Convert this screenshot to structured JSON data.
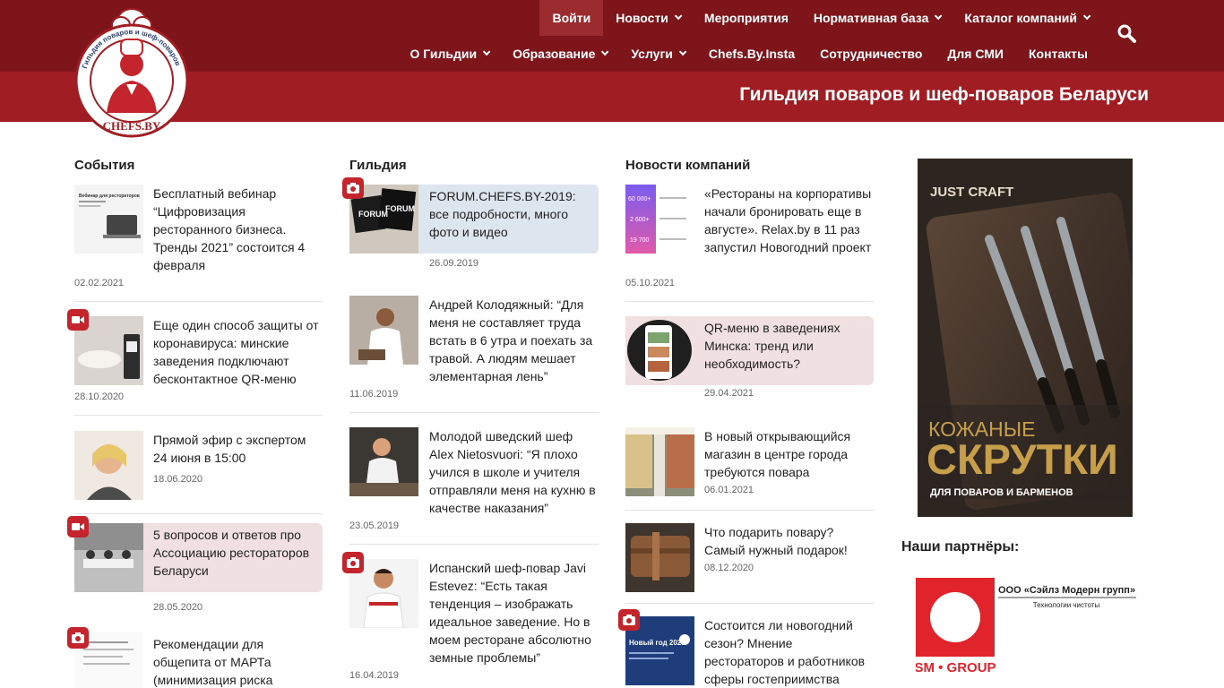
{
  "site": {
    "title": "Гильдия поваров и шеф-поваров Беларуси",
    "logo_ring_text": "Гильдия поваров и шеф-поваров",
    "logo_domain": "CHEFS.BY"
  },
  "nav": {
    "row1": [
      {
        "label": "Войти",
        "dropdown": false,
        "active": true
      },
      {
        "label": "Новости",
        "dropdown": true
      },
      {
        "label": "Мероприятия",
        "dropdown": false
      },
      {
        "label": "Нормативная база",
        "dropdown": true
      },
      {
        "label": "Каталог компаний",
        "dropdown": true
      }
    ],
    "row2": [
      {
        "label": "О Гильдии",
        "dropdown": true
      },
      {
        "label": "Образование",
        "dropdown": true
      },
      {
        "label": "Услуги",
        "dropdown": true
      },
      {
        "label": "Chefs.By.Insta",
        "dropdown": false
      },
      {
        "label": "Сотрудничество",
        "dropdown": false
      },
      {
        "label": "Для СМИ",
        "dropdown": false
      },
      {
        "label": "Контакты",
        "dropdown": false
      }
    ],
    "search_icon": "search-icon"
  },
  "columns": {
    "events": {
      "title": "События",
      "items": [
        {
          "text": "Бесплатный вебинар “Цифровизация ресторанного бизнеса. Тренды 2021” состоится 4 февраля",
          "date": "02.02.2021"
        },
        {
          "text": "Еще один способ защиты от коронавируса: минские заведения подключают бесконтактное QR-меню",
          "date": "28.10.2020",
          "badge": "video-icon"
        },
        {
          "text": "Прямой эфир с экспертом 24 июня в 15:00",
          "date": "18.06.2020"
        },
        {
          "text": "5 вопросов и ответов про Ассоциацию рестораторов Беларуси",
          "date": "28.05.2020",
          "badge": "video-icon"
        },
        {
          "text": "Рекомендации для общепита от МАРТа (минимизация риска",
          "date": "",
          "badge": "camera-icon"
        }
      ]
    },
    "guild": {
      "title": "Гильдия",
      "items": [
        {
          "text": "FORUM.CHEFS.BY-2019: все подробности, много фото и видео",
          "date": "26.09.2019",
          "badge": "camera-icon"
        },
        {
          "text": "Андрей Колодяжный: “Для меня не составляет труда встать в 6 утра и поехать за травой. А людям мешает элементарная лень”",
          "date": "11.06.2019"
        },
        {
          "text": "Молодой шведский шеф Alex Nietosvuori: “Я плохо учился в школе и учителя отправляли меня на кухню в качестве наказания”",
          "date": "23.05.2019"
        },
        {
          "text": "Испанский шеф-повар Javi Estevez: “Есть такая тенденция – изображать идеальное заведение. Но в моем ресторане абсолютно земные проблемы”",
          "date": "16.04.2019",
          "badge": "camera-icon"
        }
      ]
    },
    "companies": {
      "title": "Новости компаний",
      "items": [
        {
          "text": "«Рестораны на корпоративы начали бронировать еще в августе». Relax.by в 11 раз запустил Новогодний проект",
          "date": "05.10.2021"
        },
        {
          "text": "QR-меню в заведениях Минска: тренд или необходимость?",
          "date": "29.04.2021"
        },
        {
          "text": "В новый открывающийся магазин в центре города требуются повара",
          "date": "06.01.2021"
        },
        {
          "text": "Что подарить повару? Самый нужный подарок!",
          "date": "08.12.2020"
        },
        {
          "text": "Состоится ли новогодний сезон? Мнение рестораторов и работников сферы гостеприимства",
          "date": "",
          "badge": "camera-icon"
        }
      ]
    }
  },
  "thumbs": {
    "webinar_title": "Вебинар для рестораторов",
    "stat1": "60 000+",
    "stat2": "2 600+",
    "stat3": "19 700",
    "forum_text": "FORUM",
    "newyear_text": "Новый год 2021"
  },
  "ad": {
    "brand": "JUST CRAFT",
    "headline1": "КОЖАНЫЕ",
    "headline2": "СКРУТКИ",
    "sub": "ДЛЯ ПОВАРОВ И БАРМЕНОВ"
  },
  "partners": {
    "title": "Наши партнёры:",
    "company": "ООО «Сэйлз Модерн групп»",
    "tagline": "Технологии чистоты",
    "brand": "SM • GROUP"
  },
  "colors": {
    "topbar": "#7d151b",
    "subbar": "#a11d24",
    "badge": "#c4242b",
    "highlight_blue": "#dde5ef",
    "highlight_pink": "#f1e0e1"
  }
}
